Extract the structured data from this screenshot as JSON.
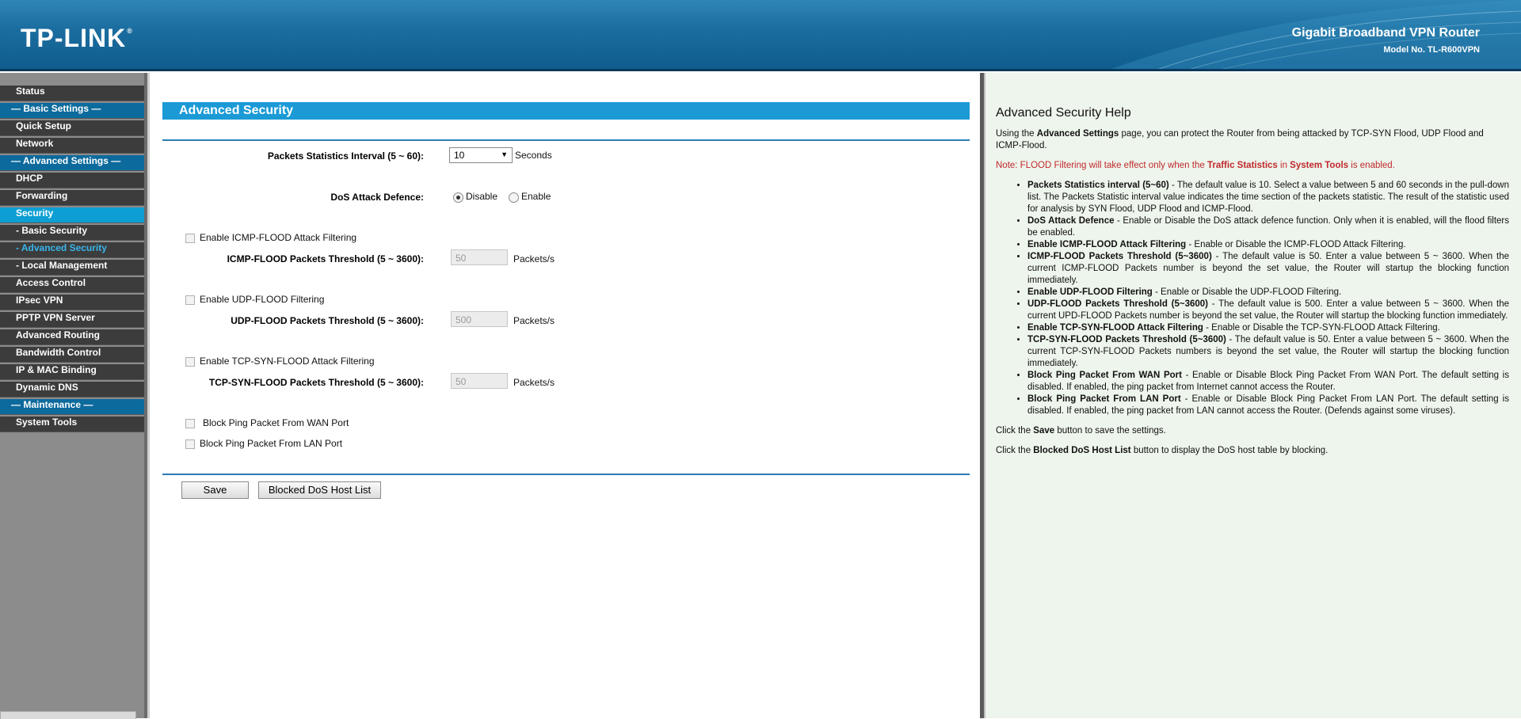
{
  "header": {
    "logo": "TP-LINK",
    "product": "Gigabit Broadband VPN Router",
    "model": "Model No. TL-R600VPN"
  },
  "sidebar": {
    "items": [
      {
        "label": "Status",
        "kind": "item"
      },
      {
        "label": "— Basic Settings —",
        "kind": "section"
      },
      {
        "label": "Quick Setup",
        "kind": "item"
      },
      {
        "label": "Network",
        "kind": "item"
      },
      {
        "label": "— Advanced Settings —",
        "kind": "section"
      },
      {
        "label": "DHCP",
        "kind": "item"
      },
      {
        "label": "Forwarding",
        "kind": "item"
      },
      {
        "label": "Security",
        "kind": "active"
      },
      {
        "label": "- Basic Security",
        "kind": "sub"
      },
      {
        "label": "- Advanced Security",
        "kind": "sub-active"
      },
      {
        "label": "- Local Management",
        "kind": "sub"
      },
      {
        "label": "Access Control",
        "kind": "item"
      },
      {
        "label": "IPsec VPN",
        "kind": "item"
      },
      {
        "label": "PPTP VPN Server",
        "kind": "item"
      },
      {
        "label": "Advanced Routing",
        "kind": "item"
      },
      {
        "label": "Bandwidth Control",
        "kind": "item"
      },
      {
        "label": "IP & MAC Binding",
        "kind": "item"
      },
      {
        "label": "Dynamic DNS",
        "kind": "item"
      },
      {
        "label": "— Maintenance —",
        "kind": "section"
      },
      {
        "label": "System Tools",
        "kind": "item"
      }
    ]
  },
  "main": {
    "title": "Advanced Security",
    "interval": {
      "label": "Packets Statistics Interval (5 ~ 60):",
      "value": "10",
      "unit": "Seconds"
    },
    "dos": {
      "label": "DoS Attack Defence:",
      "option_disable": "Disable",
      "option_enable": "Enable",
      "selected": "Disable"
    },
    "icmp": {
      "checkbox_label": "Enable ICMP-FLOOD Attack Filtering",
      "threshold_label": "ICMP-FLOOD Packets Threshold (5 ~ 3600):",
      "value": "50",
      "unit": "Packets/s"
    },
    "udp": {
      "checkbox_label": "Enable UDP-FLOOD Filtering",
      "threshold_label": "UDP-FLOOD Packets Threshold (5 ~ 3600):",
      "value": "500",
      "unit": "Packets/s"
    },
    "tcp": {
      "checkbox_label": "Enable TCP-SYN-FLOOD Attack Filtering",
      "threshold_label": "TCP-SYN-FLOOD Packets Threshold (5 ~ 3600):",
      "value": "50",
      "unit": "Packets/s"
    },
    "ping_wan": "Block Ping Packet From WAN Port",
    "ping_lan": "Block Ping Packet From LAN Port",
    "save_button": "Save",
    "blocked_button": "Blocked DoS Host List"
  },
  "help": {
    "title": "Advanced Security Help",
    "intro_1": "Using the ",
    "intro_b": "Advanced Settings",
    "intro_2": " page, you can protect the Router from being attacked by TCP-SYN Flood, UDP Flood and ICMP-Flood.",
    "note_1": "Note: FLOOD Filtering will take effect only when the ",
    "note_b1": "Traffic Statistics",
    "note_2": " in ",
    "note_b2": "System Tools",
    "note_3": " is enabled.",
    "bullets": [
      {
        "term": "Packets Statistics interval (5~60)",
        "text": " - The default value is 10. Select a value between 5 and 60 seconds in the pull-down list. The Packets Statistic interval value indicates the time section of the packets statistic. The result of the statistic used for analysis by SYN Flood, UDP Flood and ICMP-Flood."
      },
      {
        "term": "DoS Attack Defence",
        "text": " - Enable or Disable the DoS attack defence function. Only when it is enabled, will the flood filters be enabled."
      },
      {
        "term": "Enable ICMP-FLOOD Attack Filtering",
        "text": " - Enable or Disable the ICMP-FLOOD Attack Filtering."
      },
      {
        "term": "ICMP-FLOOD Packets Threshold (5~3600)",
        "text": " - The default value is 50. Enter a value between 5 ~ 3600. When the current ICMP-FLOOD Packets number is beyond the set value, the Router will startup the blocking function immediately."
      },
      {
        "term": "Enable UDP-FLOOD Filtering",
        "text": " - Enable or Disable the UDP-FLOOD Filtering."
      },
      {
        "term": "UDP-FLOOD Packets Threshold (5~3600)",
        "text": " - The default value is 500. Enter a value between 5 ~ 3600. When the current UPD-FLOOD Packets number is beyond the set value, the Router will startup the blocking function immediately."
      },
      {
        "term": "Enable TCP-SYN-FLOOD Attack Filtering",
        "text": " - Enable or Disable the TCP-SYN-FLOOD Attack Filtering."
      },
      {
        "term": "TCP-SYN-FLOOD Packets Threshold (5~3600)",
        "text": " - The default value is 50. Enter a value between 5 ~ 3600. When the current TCP-SYN-FLOOD Packets numbers is beyond the set value, the Router will startup the blocking function immediately."
      },
      {
        "term": "Block Ping Packet From WAN Port",
        "text": " - Enable or Disable Block Ping Packet From WAN Port. The default setting is disabled. If enabled, the ping packet from Internet cannot access the Router."
      },
      {
        "term": "Block Ping Packet From LAN Port",
        "text": " - Enable or Disable Block Ping Packet From LAN Port. The default setting is disabled. If enabled, the ping packet from LAN cannot access the Router. (Defends against some viruses)."
      }
    ],
    "save_1": "Click the ",
    "save_b": "Save",
    "save_2": " button to save the settings.",
    "blocked_1": "Click the ",
    "blocked_b": "Blocked DoS Host List",
    "blocked_2": " button to display the DoS host table by blocking."
  },
  "colors": {
    "accent": "#1b9ad6",
    "section": "#0d6a9c",
    "note": "#c0282d",
    "help_bg": "#eef5ec"
  }
}
